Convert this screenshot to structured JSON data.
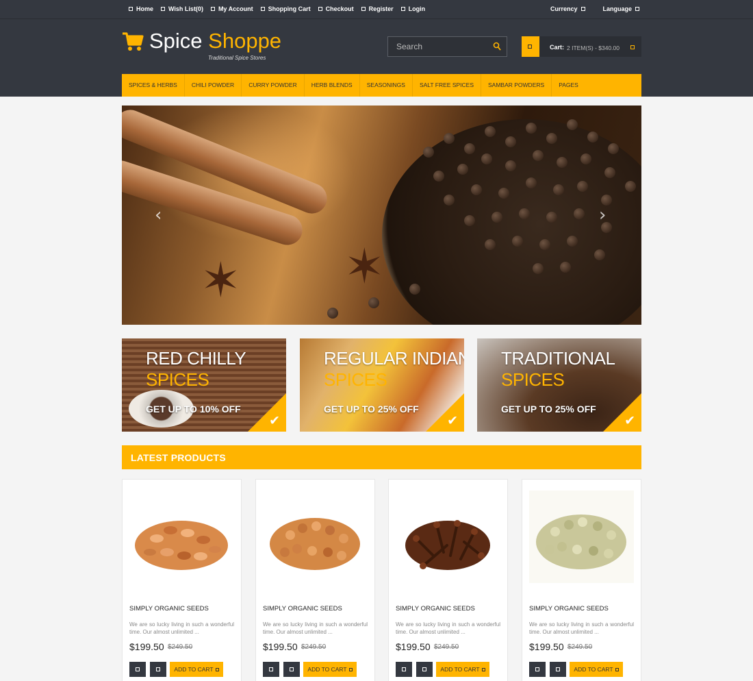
{
  "toplinks": [
    "Home",
    "Wish List(0)",
    "My Account",
    "Shopping Cart",
    "Checkout",
    "Register",
    "Login"
  ],
  "topright": [
    "Currency",
    "Language"
  ],
  "logo": {
    "word1": "Spice",
    "word2": "Shoppe",
    "tagline": "Traditional Spice Stores",
    "icon": "cart-icon"
  },
  "search": {
    "placeholder": "Search",
    "icon": "search-icon"
  },
  "cart": {
    "label": "Cart:",
    "value": "2 ITEM(S) - $340.00"
  },
  "nav": [
    "SPICES & HERBS",
    "CHILI POWDER",
    "CURRY POWDER",
    "HERB BLENDS",
    "SEASONINGS",
    "SALT FREE SPICES",
    "SAMBAR POWDERS",
    "PAGES"
  ],
  "hero": {
    "prev": "‹",
    "next": "›"
  },
  "banners": [
    {
      "title": "RED CHILLY",
      "sub": "SPICES",
      "offer": "GET UP TO 10% OFF"
    },
    {
      "title": "REGULAR INDIAN",
      "sub": "SPICES",
      "offer": "GET UP TO 25% OFF"
    },
    {
      "title": "TRADITIONAL",
      "sub": "SPICES",
      "offer": "GET UP TO 25% OFF"
    }
  ],
  "section": {
    "title": "LATEST PRODUCTS"
  },
  "products": [
    {
      "name": "SIMPLY ORGANIC SEEDS",
      "desc": "We are so lucky living in such a wonderful time. Our almost unlimited ...",
      "price": "$199.50",
      "old_price": "$249.50",
      "add": "ADD TO CART"
    },
    {
      "name": "SIMPLY ORGANIC SEEDS",
      "desc": "We are so lucky living in such a wonderful time. Our almost unlimited ...",
      "price": "$199.50",
      "old_price": "$249.50",
      "add": "ADD TO CART"
    },
    {
      "name": "SIMPLY ORGANIC SEEDS",
      "desc": "We are so lucky living in such a wonderful time. Our almost unlimited ...",
      "price": "$199.50",
      "old_price": "$249.50",
      "add": "ADD TO CART"
    },
    {
      "name": "SIMPLY ORGANIC SEEDS",
      "desc": "We are so lucky living in such a wonderful time. Our almost unlimited ...",
      "price": "$199.50",
      "old_price": "$249.50",
      "add": "ADD TO CART"
    }
  ],
  "colors": {
    "accent": "#ffb400",
    "header": "#343840",
    "background": "#f4f4f4"
  }
}
